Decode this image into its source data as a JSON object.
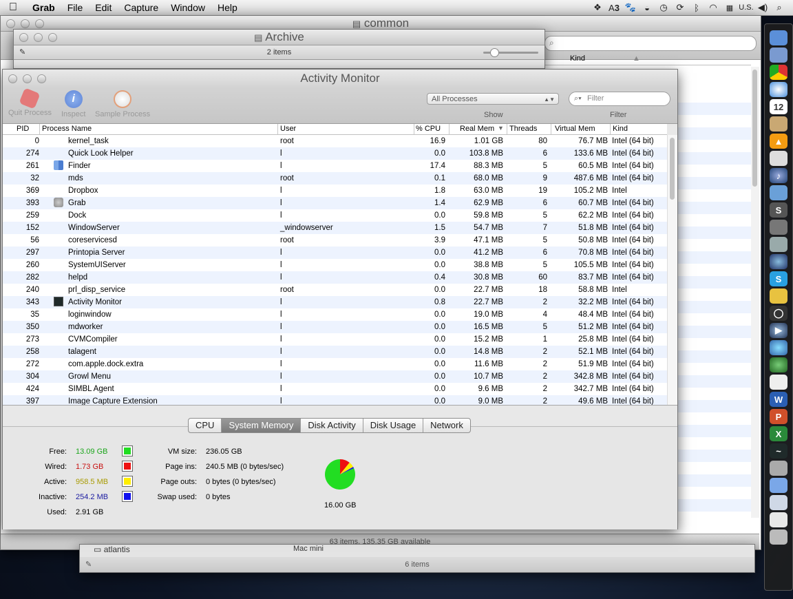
{
  "menubar": {
    "apple": "",
    "items": [
      "Grab",
      "File",
      "Edit",
      "Capture",
      "Window",
      "Help"
    ],
    "status": {
      "badge": "3",
      "locale": "U.S."
    }
  },
  "back_window": {
    "title": "common",
    "status": "63 items, 135.35 GB available",
    "col_kind": "Kind"
  },
  "archive_window": {
    "title": "Archive",
    "count": "2 items"
  },
  "bottom_window": {
    "count": "6 items",
    "row": "atlantis",
    "row2": "Mac mini"
  },
  "activity_monitor": {
    "title": "Activity Monitor",
    "toolbar": {
      "quit": "Quit Process",
      "inspect": "Inspect",
      "sample": "Sample Process",
      "show_select": "All Processes",
      "show_label": "Show",
      "filter_placeholder": "Filter",
      "filter_label": "Filter"
    },
    "columns": [
      "PID",
      "Process Name",
      "User",
      "% CPU",
      "Real Mem",
      "Threads",
      "Virtual Mem",
      "Kind"
    ],
    "sort_indicator": "▼",
    "rows": [
      {
        "pid": "0",
        "name": "kernel_task",
        "user": "root",
        "cpu": "16.9",
        "real": "1.01 GB",
        "threads": "80",
        "virt": "76.7 MB",
        "kind": "Intel (64 bit)",
        "icon": ""
      },
      {
        "pid": "274",
        "name": "Quick Look Helper",
        "user": "l",
        "cpu": "0.0",
        "real": "103.8 MB",
        "threads": "6",
        "virt": "133.6 MB",
        "kind": "Intel (64 bit)",
        "icon": ""
      },
      {
        "pid": "261",
        "name": "Finder",
        "user": "l",
        "cpu": "17.4",
        "real": "88.3 MB",
        "threads": "5",
        "virt": "60.5 MB",
        "kind": "Intel (64 bit)",
        "icon": "finder"
      },
      {
        "pid": "32",
        "name": "mds",
        "user": "root",
        "cpu": "0.1",
        "real": "68.0 MB",
        "threads": "9",
        "virt": "487.6 MB",
        "kind": "Intel (64 bit)",
        "icon": ""
      },
      {
        "pid": "369",
        "name": "Dropbox",
        "user": "l",
        "cpu": "1.8",
        "real": "63.0 MB",
        "threads": "19",
        "virt": "105.2 MB",
        "kind": "Intel",
        "icon": ""
      },
      {
        "pid": "393",
        "name": "Grab",
        "user": "l",
        "cpu": "1.4",
        "real": "62.9 MB",
        "threads": "6",
        "virt": "60.7 MB",
        "kind": "Intel (64 bit)",
        "icon": "grab"
      },
      {
        "pid": "259",
        "name": "Dock",
        "user": "l",
        "cpu": "0.0",
        "real": "59.8 MB",
        "threads": "5",
        "virt": "62.2 MB",
        "kind": "Intel (64 bit)",
        "icon": ""
      },
      {
        "pid": "152",
        "name": "WindowServer",
        "user": "_windowserver",
        "cpu": "1.5",
        "real": "54.7 MB",
        "threads": "7",
        "virt": "51.8 MB",
        "kind": "Intel (64 bit)",
        "icon": ""
      },
      {
        "pid": "56",
        "name": "coreservicesd",
        "user": "root",
        "cpu": "3.9",
        "real": "47.1 MB",
        "threads": "5",
        "virt": "50.8 MB",
        "kind": "Intel (64 bit)",
        "icon": ""
      },
      {
        "pid": "297",
        "name": "Printopia Server",
        "user": "l",
        "cpu": "0.0",
        "real": "41.2 MB",
        "threads": "6",
        "virt": "70.8 MB",
        "kind": "Intel (64 bit)",
        "icon": ""
      },
      {
        "pid": "260",
        "name": "SystemUIServer",
        "user": "l",
        "cpu": "0.0",
        "real": "38.8 MB",
        "threads": "5",
        "virt": "105.5 MB",
        "kind": "Intel (64 bit)",
        "icon": ""
      },
      {
        "pid": "282",
        "name": "helpd",
        "user": "l",
        "cpu": "0.4",
        "real": "30.8 MB",
        "threads": "60",
        "virt": "83.7 MB",
        "kind": "Intel (64 bit)",
        "icon": ""
      },
      {
        "pid": "240",
        "name": "prl_disp_service",
        "user": "root",
        "cpu": "0.0",
        "real": "22.7 MB",
        "threads": "18",
        "virt": "58.8 MB",
        "kind": "Intel",
        "icon": ""
      },
      {
        "pid": "343",
        "name": "Activity Monitor",
        "user": "l",
        "cpu": "0.8",
        "real": "22.7 MB",
        "threads": "2",
        "virt": "32.2 MB",
        "kind": "Intel (64 bit)",
        "icon": "actmon"
      },
      {
        "pid": "35",
        "name": "loginwindow",
        "user": "l",
        "cpu": "0.0",
        "real": "19.0 MB",
        "threads": "4",
        "virt": "48.4 MB",
        "kind": "Intel (64 bit)",
        "icon": ""
      },
      {
        "pid": "350",
        "name": "mdworker",
        "user": "l",
        "cpu": "0.0",
        "real": "16.5 MB",
        "threads": "5",
        "virt": "51.2 MB",
        "kind": "Intel (64 bit)",
        "icon": ""
      },
      {
        "pid": "273",
        "name": "CVMCompiler",
        "user": "l",
        "cpu": "0.0",
        "real": "15.2 MB",
        "threads": "1",
        "virt": "25.8 MB",
        "kind": "Intel (64 bit)",
        "icon": ""
      },
      {
        "pid": "258",
        "name": "talagent",
        "user": "l",
        "cpu": "0.0",
        "real": "14.8 MB",
        "threads": "2",
        "virt": "52.1 MB",
        "kind": "Intel (64 bit)",
        "icon": ""
      },
      {
        "pid": "272",
        "name": "com.apple.dock.extra",
        "user": "l",
        "cpu": "0.0",
        "real": "11.6 MB",
        "threads": "2",
        "virt": "51.9 MB",
        "kind": "Intel (64 bit)",
        "icon": ""
      },
      {
        "pid": "304",
        "name": "Growl Menu",
        "user": "l",
        "cpu": "0.0",
        "real": "10.7 MB",
        "threads": "2",
        "virt": "342.8 MB",
        "kind": "Intel (64 bit)",
        "icon": ""
      },
      {
        "pid": "424",
        "name": "SIMBL Agent",
        "user": "l",
        "cpu": "0.0",
        "real": "9.6 MB",
        "threads": "2",
        "virt": "342.7 MB",
        "kind": "Intel (64 bit)",
        "icon": ""
      },
      {
        "pid": "397",
        "name": "Image Capture Extension",
        "user": "l",
        "cpu": "0.0",
        "real": "9.0 MB",
        "threads": "2",
        "virt": "49.6 MB",
        "kind": "Intel (64 bit)",
        "icon": ""
      }
    ],
    "tabs": [
      "CPU",
      "System Memory",
      "Disk Activity",
      "Disk Usage",
      "Network"
    ],
    "selected_tab": "System Memory",
    "memory": {
      "free_label": "Free:",
      "free": "13.09 GB",
      "free_color": "#1aa51a",
      "wired_label": "Wired:",
      "wired": "1.73 GB",
      "wired_color": "#c81010",
      "active_label": "Active:",
      "active": "958.5 MB",
      "active_color": "#a89a00",
      "inactive_label": "Inactive:",
      "inactive": "254.2 MB",
      "inactive_color": "#1a1aa0",
      "used_label": "Used:",
      "used": "2.91 GB",
      "vmsize_label": "VM size:",
      "vmsize": "236.05 GB",
      "pageins_label": "Page ins:",
      "pageins": "240.5 MB (0 bytes/sec)",
      "pageouts_label": "Page outs:",
      "pageouts": "0 bytes (0 bytes/sec)",
      "swap_label": "Swap used:",
      "swap": "0 bytes",
      "total": "16.00 GB",
      "pie": {
        "free": 13.09,
        "wired": 1.73,
        "active": 0.9585,
        "inactive": 0.2542
      }
    }
  }
}
